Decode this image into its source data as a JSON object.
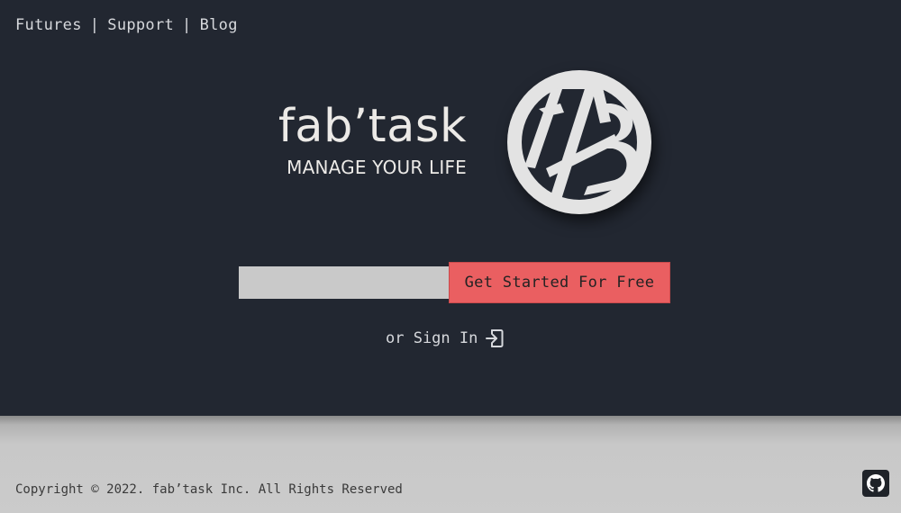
{
  "nav": {
    "items": [
      {
        "label": "Futures"
      },
      {
        "label": "Support"
      },
      {
        "label": "Blog"
      }
    ],
    "separator": "|"
  },
  "brand": {
    "name": "fab’task",
    "tagline": "MANAGE YOUR LIFE",
    "logo_letters": "FAB"
  },
  "signup": {
    "email_value": "",
    "email_placeholder": "",
    "cta_label": "Get Started For Free"
  },
  "signin": {
    "label": "or Sign In",
    "icon": "sign-in-icon"
  },
  "footer": {
    "copyright": "Copyright © 2022. fab’task Inc. All Rights Reserved",
    "github_icon": "github-icon"
  },
  "colors": {
    "background": "#222731",
    "accent": "#ea5f61",
    "footer": "#cbcbcb",
    "text_light": "#d6d8dc",
    "logo_fill": "#e3e3e3"
  }
}
